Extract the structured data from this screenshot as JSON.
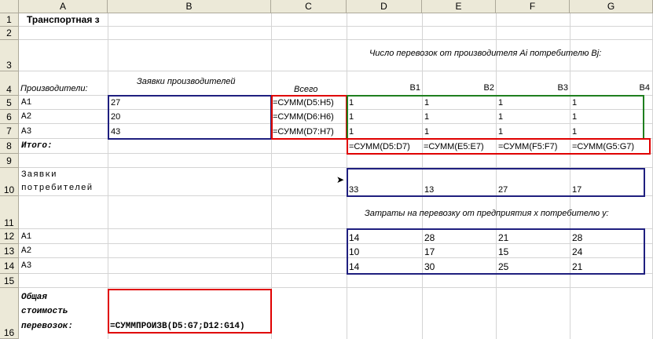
{
  "columns": [
    "A",
    "B",
    "C",
    "D",
    "E",
    "F",
    "G"
  ],
  "rows": [
    "1",
    "2",
    "3",
    "4",
    "5",
    "6",
    "7",
    "8",
    "9",
    "10",
    "11",
    "12",
    "13",
    "14",
    "15",
    "16"
  ],
  "title": "Транспортная з",
  "header_shipments": "Число перевозок от производителя Ai потребителю Bj:",
  "producers_label": "Производители:",
  "producer_requests_label": "Заявки производителей",
  "total_label": "Всего",
  "consumers": [
    "B1",
    "B2",
    "B3",
    "B4"
  ],
  "producers": [
    "A1",
    "A2",
    "A3"
  ],
  "producer_requests": [
    "27",
    "20",
    "43"
  ],
  "row_sums": [
    "=СУММ(D5:H5)",
    "=СУММ(D6:H6)",
    "=СУММ(D7:H7)"
  ],
  "shipments": [
    [
      "1",
      "1",
      "1",
      "1"
    ],
    [
      "1",
      "1",
      "1",
      "1"
    ],
    [
      "1",
      "1",
      "1",
      "1"
    ]
  ],
  "itogo_label": "Итого:",
  "col_sums": [
    "=СУММ(D5:D7)",
    "=СУММ(E5:E7)",
    "=СУММ(F5:F7)",
    "=СУММ(G5:G7)"
  ],
  "consumer_requests_label_1": "Заявки",
  "consumer_requests_label_2": "потребителей",
  "consumer_requests": [
    "33",
    "13",
    "27",
    "17"
  ],
  "costs_header": "Затраты на перевозку от предприятия x потребителю y:",
  "cost_producers": [
    "A1",
    "A2",
    "A3"
  ],
  "costs": [
    [
      "14",
      "28",
      "21",
      "28"
    ],
    [
      "10",
      "17",
      "15",
      "24"
    ],
    [
      "14",
      "30",
      "25",
      "21"
    ]
  ],
  "total_cost_label_1": "Общая",
  "total_cost_label_2": "стоимость",
  "total_cost_label_3": "перевозок:",
  "total_cost_formula": "=СУММПРОИЗВ(D5:G7;D12:G14)"
}
